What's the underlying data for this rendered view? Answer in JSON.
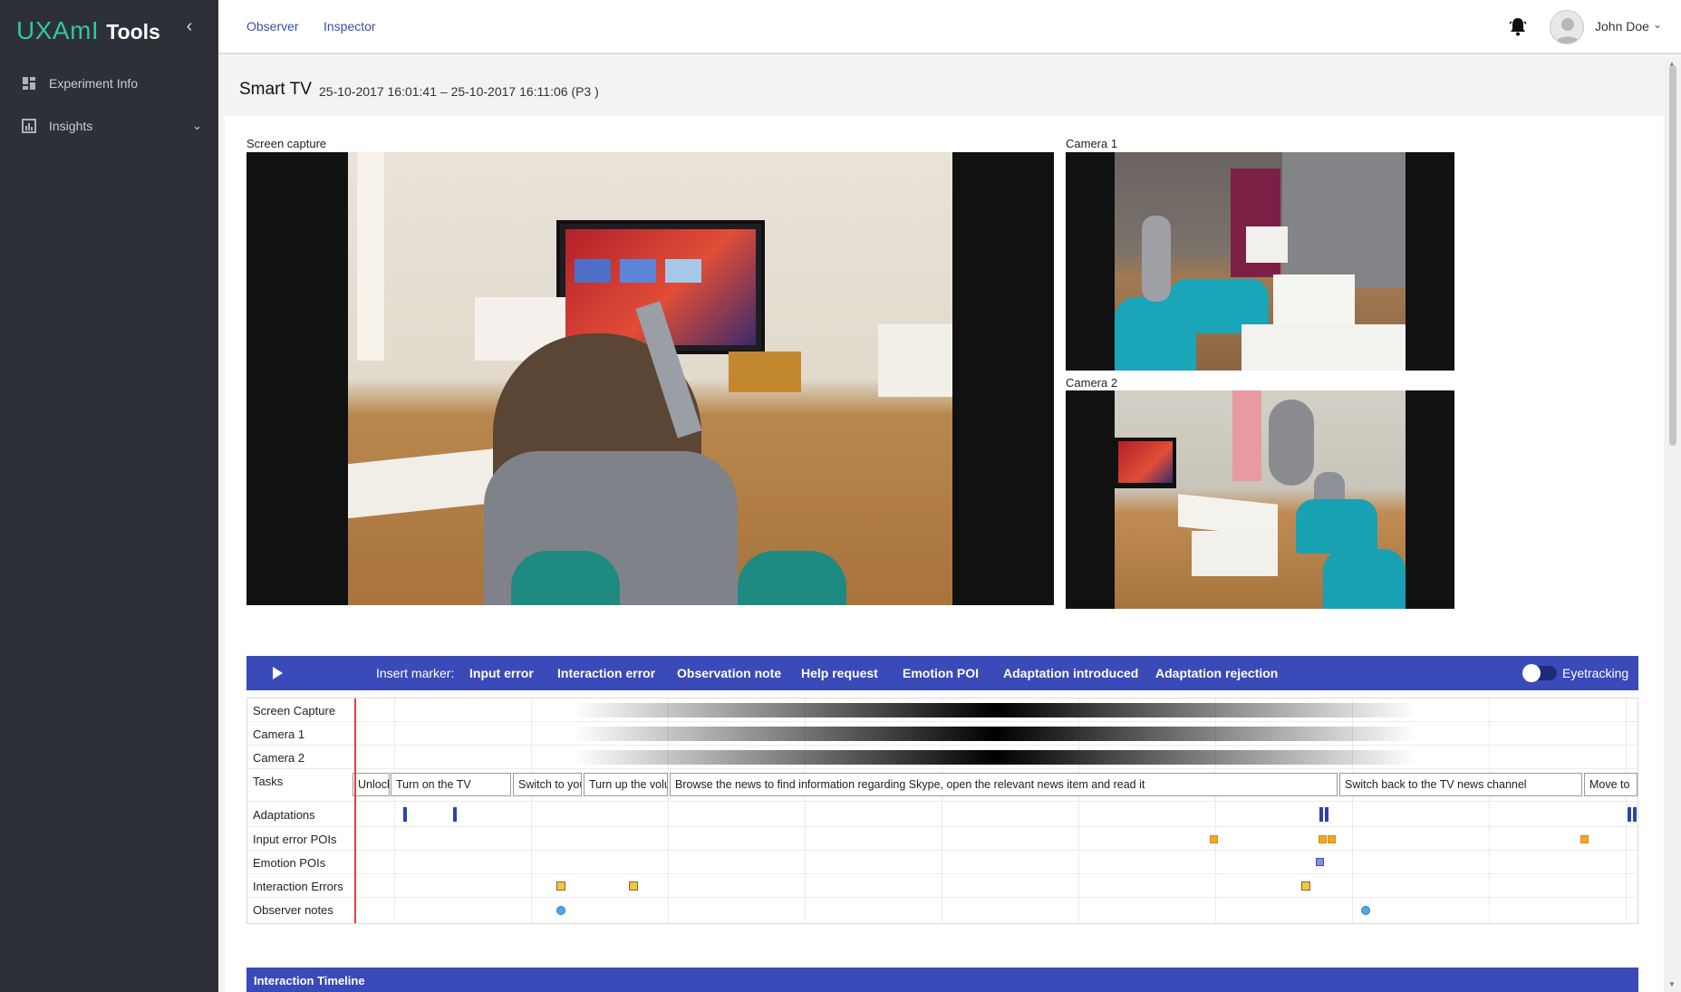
{
  "app": {
    "brand_main": "UXAmI",
    "brand_suffix": "Tools",
    "brand_color": "#34c3a4"
  },
  "sidebar": {
    "items": [
      {
        "label": "Experiment Info",
        "icon": "dashboard-icon"
      },
      {
        "label": "Insights",
        "icon": "chart-icon"
      }
    ]
  },
  "topbar": {
    "tabs": [
      "Observer",
      "Inspector"
    ],
    "user_name": "John Doe"
  },
  "page": {
    "title": "Smart TV",
    "subtitle": "25-10-2017 16:01:41 – 25-10-2017 16:11:06 (P3 )"
  },
  "videos": {
    "screen_capture": "Screen capture",
    "camera1": "Camera 1",
    "camera2": "Camera 2"
  },
  "player": {
    "insert_marker_label": "Insert marker:",
    "markers": [
      "Input error",
      "Interaction error",
      "Observation note",
      "Help request",
      "Emotion POI",
      "Adaptation introduced",
      "Adaptation rejection"
    ],
    "eyetracking_label": "Eyetracking",
    "eyetracking_on": false,
    "accent_color": "#3a4ab8"
  },
  "timeline": {
    "rows": [
      "Screen Capture",
      "Camera 1",
      "Camera 2",
      "Tasks",
      "Adaptations",
      "Input error POIs",
      "Emotion POIs",
      "Interaction Errors",
      "Observer notes"
    ],
    "tasks": [
      "Unlock",
      "Turn on the TV",
      "Switch to your favourite channel",
      "Turn up the volume",
      "Browse the news to find information regarding Skype, open the relevant news item and read it",
      "Switch back to the TV news channel",
      "Move to"
    ]
  },
  "interaction_timeline": {
    "title": "Interaction Timeline"
  }
}
